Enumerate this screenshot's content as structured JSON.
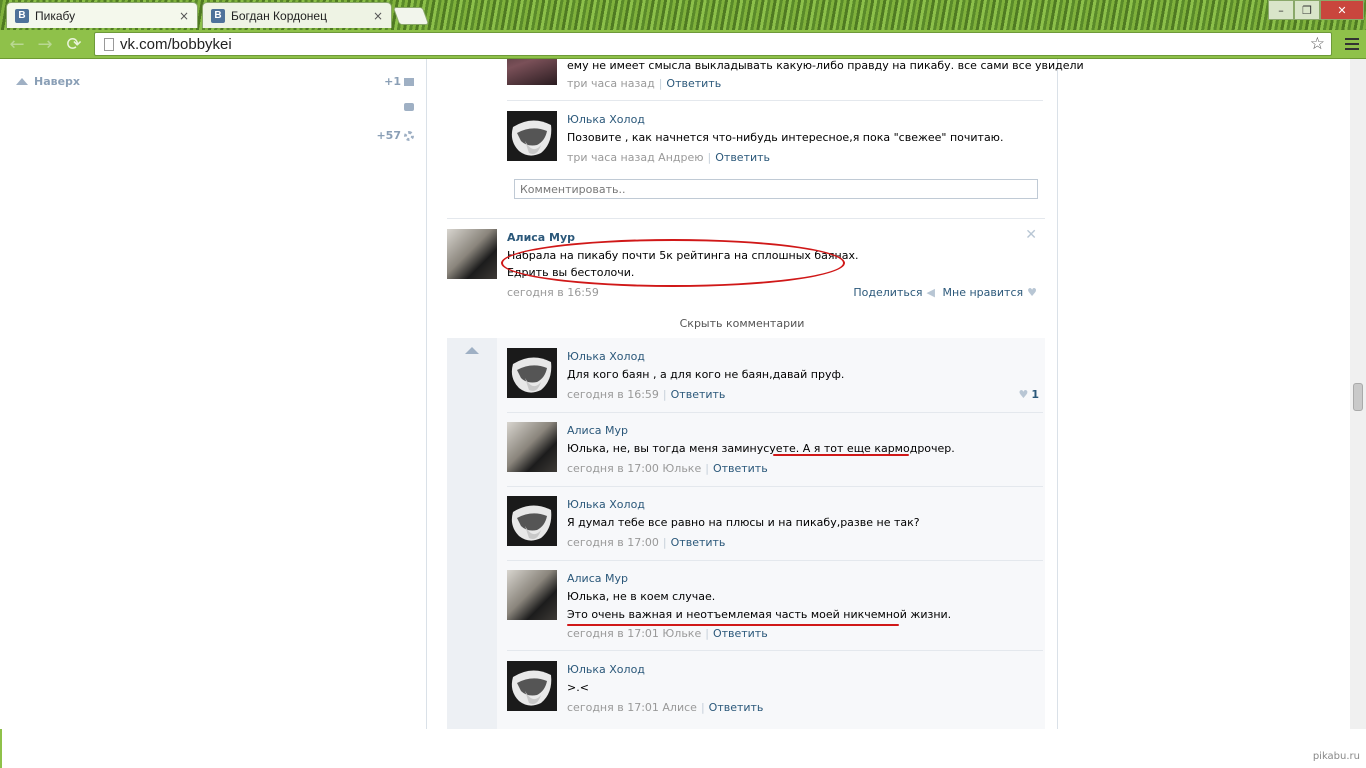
{
  "browser": {
    "tabs": [
      {
        "label": "Пикабу",
        "active": true
      },
      {
        "label": "Богдан Кордонец",
        "active": false
      }
    ],
    "url": "vk.com/bobbykei",
    "tab_close": "×",
    "window_min": "–",
    "window_max": "❐",
    "window_close": "✕"
  },
  "sidebar": {
    "up_label": "Наверх",
    "msg_count": "+1",
    "notif_count": "+57"
  },
  "thread_top": [
    {
      "text": "ему не имеет смысла выкладывать какую-либо правду на пикабу. все сами все увидели",
      "time": "три часа назад",
      "reply": "Ответить"
    },
    {
      "author": "Юлька Холод",
      "text": "Позовите , как начнется что-нибудь интересное,я пока \"свежее\" почитаю.",
      "time": "три часа назад Андрею",
      "reply": "Ответить"
    }
  ],
  "comment_placeholder": "Комментировать..",
  "post": {
    "author": "Алиса Мур",
    "line1": "Набрала на пикабу почти 5к рейтинга на сплошных баянах.",
    "line2": "Едрить вы бестолочи.",
    "time": "сегодня в 16:59",
    "share": "Поделиться",
    "like": "Мне нравится",
    "hide_comments": "Скрыть комментарии"
  },
  "replies": [
    {
      "author": "Юлька Холод",
      "text": "Для кого баян , а для кого не баян,давай пруф.",
      "time": "сегодня в 16:59",
      "reply": "Ответить",
      "likes": "1"
    },
    {
      "author": "Алиса Мур",
      "text": "Юлька, не, вы тогда меня заминусуете. А я тот еще кармодрочер.",
      "time": "сегодня в 17:00 Юльке",
      "reply": "Ответить"
    },
    {
      "author": "Юлька Холод",
      "text": "Я думал тебе все равно на плюсы и на пикабу,разве не так?",
      "time": "сегодня в 17:00",
      "reply": "Ответить"
    },
    {
      "author": "Алиса Мур",
      "line1": "Юлька, не в коем случае.",
      "line2": "Это очень важная и неотъемлемая часть моей никчемной жизни.",
      "time": "сегодня в 17:01 Юльке",
      "reply": "Ответить"
    },
    {
      "author": "Юлька Холод",
      "text": ">.<",
      "time": "сегодня в 17:01 Алисе",
      "reply": "Ответить"
    }
  ],
  "watermark": "pikabu.ru",
  "colors": {
    "link": "#2b587a",
    "meta": "#999999",
    "annotation": "#d01818",
    "chrome_green": "#8fc14a"
  }
}
